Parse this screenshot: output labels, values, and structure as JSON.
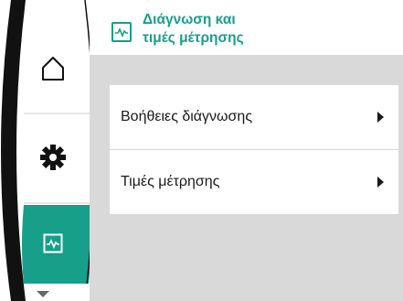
{
  "header": {
    "title_line1": "Διάγνωση και",
    "title_line2": "τιμές μέτρησης",
    "icon": "pulse-monitor-icon"
  },
  "nav": {
    "items": [
      {
        "name": "home",
        "icon": "home-icon"
      },
      {
        "name": "settings",
        "icon": "gear-icon"
      },
      {
        "name": "diagnostics",
        "icon": "pulse-monitor-icon",
        "active": true
      }
    ],
    "more_icon": "chevron-down-icon"
  },
  "menu": {
    "items": [
      {
        "label": "Βοήθειες διάγνωσης"
      },
      {
        "label": "Τιμές μέτρησης"
      }
    ]
  },
  "colors": {
    "accent": "#179f8a",
    "background": "#d9d9d9",
    "nav_active": "#179f8a"
  }
}
